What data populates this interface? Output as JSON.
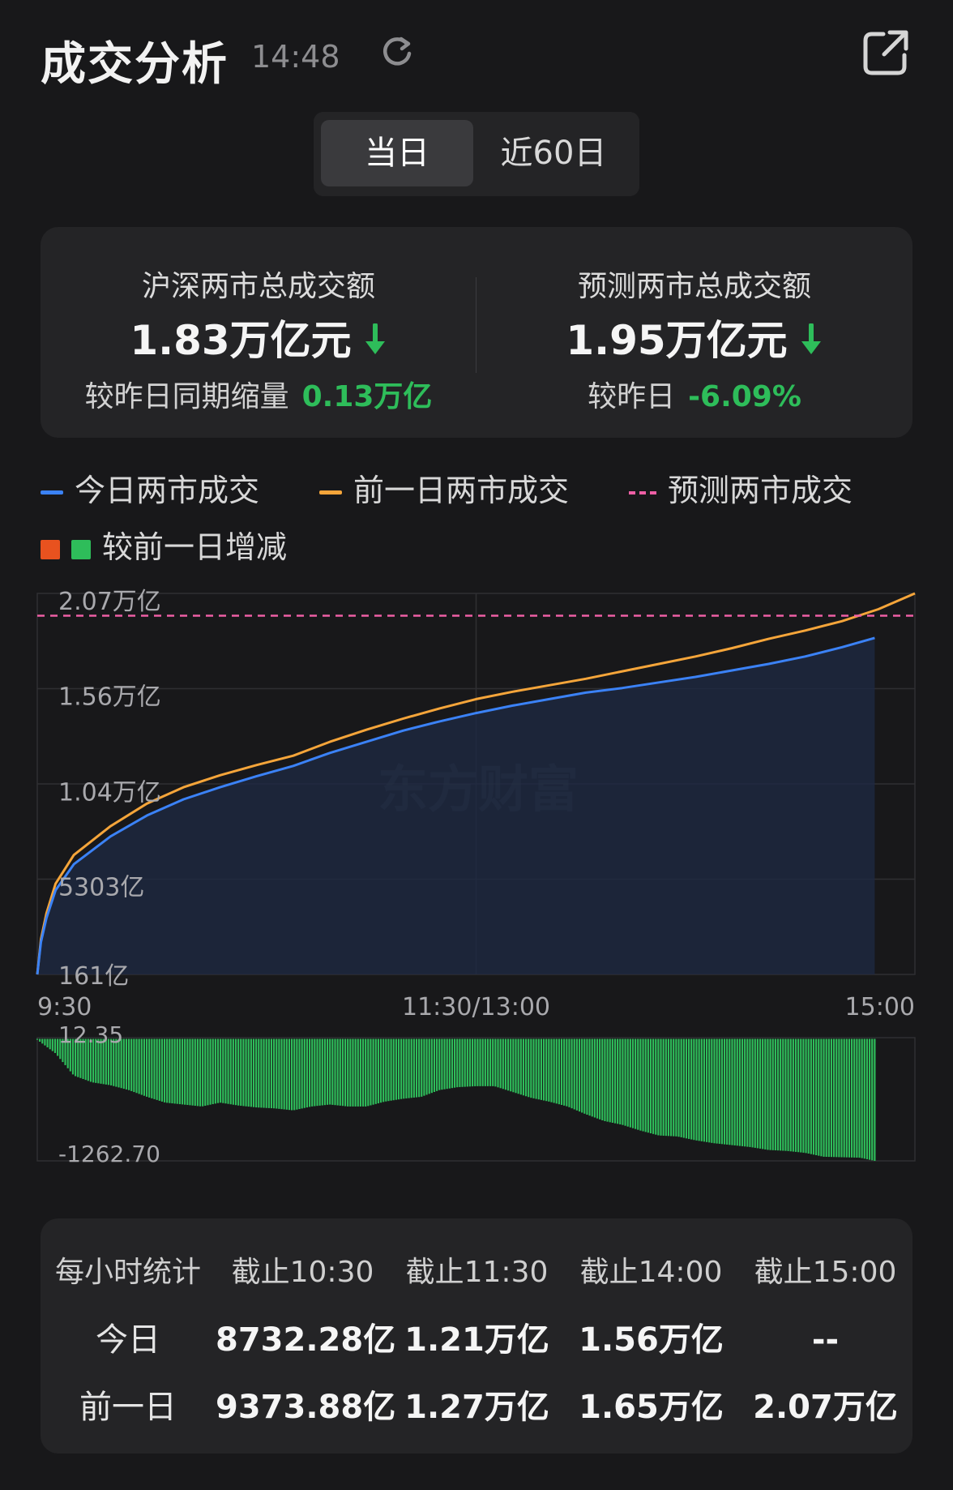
{
  "header": {
    "title": "成交分析",
    "time": "14:48",
    "icons": {
      "refresh": "refresh-icon",
      "share": "external-link-icon"
    }
  },
  "tabs": [
    {
      "label": "当日",
      "active": true
    },
    {
      "label": "近60日",
      "active": false
    }
  ],
  "summary": {
    "left": {
      "label": "沪深两市总成交额",
      "value": "1.83万亿元",
      "compare_label": "较昨日同期缩量",
      "compare_value": "0.13万亿",
      "trend": "down"
    },
    "right": {
      "label": "预测两市总成交额",
      "value": "1.95万亿元",
      "compare_label": "较昨日",
      "compare_value": "-6.09%",
      "trend": "down"
    }
  },
  "legend": {
    "today": "今日两市成交",
    "prev": "前一日两市成交",
    "forecast": "预测两市成交",
    "diff": "较前一日增减"
  },
  "colors": {
    "today": "#3b82f6",
    "prev": "#f5a53a",
    "forecast": "#ee5fa5",
    "increase": "#e8521f",
    "decrease": "#2ebd5a",
    "background": "#18181a",
    "card": "#242426"
  },
  "chart_data": [
    {
      "type": "line",
      "y_ticks": [
        "2.07万亿",
        "1.56万亿",
        "1.04万亿",
        "5303亿",
        "161亿"
      ],
      "x_ticks": [
        "9:30",
        "11:30/13:00",
        "15:00"
      ],
      "ylim": [
        161,
        20700
      ],
      "unit": "亿",
      "watermark": "东方财富",
      "forecast": 19500,
      "series": [
        {
          "name": "今日两市成交",
          "x": [
            0,
            0.1,
            0.25,
            0.5,
            1,
            2,
            3,
            4,
            5,
            6,
            7,
            8,
            9,
            10,
            11,
            12,
            13,
            14,
            15,
            16,
            17,
            18,
            19,
            20,
            21,
            22,
            22.9
          ],
          "y": [
            161,
            1900,
            3200,
            4700,
            6100,
            7600,
            8732,
            9600,
            10250,
            10850,
            11400,
            12100,
            12700,
            13300,
            13800,
            14250,
            14650,
            15000,
            15350,
            15600,
            15900,
            16200,
            16550,
            16900,
            17300,
            17800,
            18300
          ]
        },
        {
          "name": "前一日两市成交",
          "x": [
            0,
            0.1,
            0.25,
            0.5,
            1,
            2,
            3,
            4,
            5,
            6,
            7,
            8,
            9,
            10,
            11,
            12,
            13,
            14,
            15,
            16,
            17,
            18,
            19,
            20,
            21,
            22,
            23,
            24
          ],
          "y": [
            161,
            2050,
            3450,
            5050,
            6600,
            8150,
            9374,
            10250,
            10900,
            11450,
            11950,
            12700,
            13350,
            13950,
            14500,
            15000,
            15400,
            15750,
            16100,
            16500,
            16900,
            17300,
            17750,
            18250,
            18700,
            19200,
            19850,
            20700
          ]
        }
      ]
    },
    {
      "type": "bar",
      "ylim": [
        -1262.7,
        12.35
      ],
      "y_ticks": [
        "12.35",
        "-1262.70"
      ],
      "name": "较前一日增减",
      "x": [
        0,
        0.5,
        1,
        1.5,
        2,
        2.5,
        3,
        3.5,
        4,
        4.5,
        5,
        5.5,
        6,
        6.5,
        7,
        7.5,
        8,
        8.5,
        9,
        9.5,
        10,
        10.5,
        11,
        11.5,
        12,
        12.5,
        13,
        13.5,
        14,
        14.5,
        15,
        15.5,
        16,
        16.5,
        17,
        17.5,
        18,
        18.5,
        19,
        19.5,
        20,
        20.5,
        21,
        21.5,
        22,
        22.5,
        22.9
      ],
      "values": [
        -10,
        -150,
        -380,
        -450,
        -480,
        -530,
        -600,
        -660,
        -680,
        -700,
        -660,
        -690,
        -710,
        -720,
        -740,
        -700,
        -680,
        -700,
        -700,
        -650,
        -620,
        -600,
        -530,
        -500,
        -490,
        -490,
        -550,
        -610,
        -650,
        -700,
        -780,
        -850,
        -890,
        -950,
        -1000,
        -1010,
        -1050,
        -1080,
        -1100,
        -1120,
        -1150,
        -1160,
        -1180,
        -1220,
        -1225,
        -1230,
        -1262.7
      ]
    }
  ],
  "stats": {
    "headers": [
      "每小时统计",
      "截止10:30",
      "截止11:30",
      "截止14:00",
      "截止15:00"
    ],
    "rows": [
      {
        "label": "今日",
        "values": [
          "8732.28亿",
          "1.21万亿",
          "1.56万亿",
          "--"
        ]
      },
      {
        "label": "前一日",
        "values": [
          "9373.88亿",
          "1.27万亿",
          "1.65万亿",
          "2.07万亿"
        ]
      }
    ]
  }
}
